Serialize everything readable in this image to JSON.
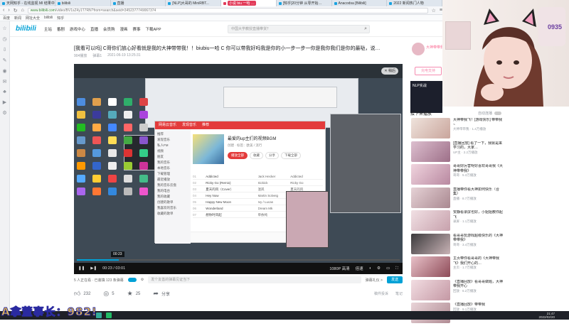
{
  "browser": {
    "tabs": [
      {
        "label": "天网知乎 - 在线监视 MI 结果中",
        "active": false
      },
      {
        "label": "bilibili",
        "active": false
      },
      {
        "label": "直播",
        "active": false
      },
      {
        "label": "[NLP]大哥的 MiniRBT...",
        "active": false
      },
      {
        "label": "小说 biu 一哈 …",
        "active": true
      },
      {
        "label": "[知乎]20分钟 从零开始…",
        "active": false
      },
      {
        "label": "Anacodsa [Bilibili]",
        "active": false
      },
      {
        "label": "2022 新闻热门人物",
        "active": false
      }
    ],
    "url_host": "www.bilibili.com",
    "url_path": "/video/BV1sZ4y1T7RN?from=search&seid=3452377749067374",
    "bookmarks": [
      "百度",
      "新闻",
      "网址大全",
      "bilibili",
      "知乎"
    ]
  },
  "bili": {
    "logo": "bilibili",
    "nav": [
      "主站",
      "番剧",
      "游戏中心",
      "直播",
      "会员购",
      "漫画",
      "赛事",
      "下载APP"
    ],
    "search_placeholder": "中国大学教授直播带货？"
  },
  "video": {
    "title": "[我看可以吗] C哥你们放心好看就是我的大神带带我！！biubiu一哈 C 你可以带我好吗我是你的小一步一步一你是我你我们是你的最哒，说…",
    "views": "904播放",
    "danmaku_count": "弹幕1",
    "date": "2021-06-19 13:25:31",
    "float_btn": "✕ 稍后",
    "time_tip": "00:23",
    "current_time": "00:23 / 03:01",
    "quality": "1080P 高清",
    "speed": "倍速",
    "progress": 0.13
  },
  "music_app": {
    "tabs": [
      "网易云音乐",
      "发现音乐",
      "推荐"
    ],
    "sidebar": [
      "推荐",
      "发现音乐",
      "私人FM",
      "视频",
      "朋友",
      "我的音乐",
      "本地音乐",
      "下载管理",
      "最近播放",
      "我的音乐云盘",
      "我的电台",
      "我的收藏",
      "创建的歌单",
      "我喜欢的音乐",
      "收藏的歌单"
    ],
    "playlist_title": "最爱的up主们的视频BGM",
    "playlist_sub": "创建 · 标签：欧美 / 流行",
    "buttons": [
      "播放全部",
      "收藏",
      "分享",
      "下载全部"
    ],
    "tracks": [
      {
        "n": "01",
        "t": "Addicted",
        "a": "Jack Hecker",
        "al": "Addicted"
      },
      {
        "n": "02",
        "t": "Ricky Go (Remix)",
        "a": "Sickick",
        "al": "Ricky Go"
      },
      {
        "n": "03",
        "t": "夏天的风（Cover）",
        "a": "温岚",
        "al": "夏天的风"
      },
      {
        "n": "04",
        "t": "Hey Now",
        "a": "Martin Solveig",
        "al": "Hey Now"
      },
      {
        "n": "05",
        "t": "Happy New Moon",
        "a": "Ivy / Lucas",
        "al": "Happy New"
      },
      {
        "n": "06",
        "t": "Wonderland",
        "a": "Dream Mk",
        "al": "Wonderland"
      },
      {
        "n": "07",
        "t": "想你时风起",
        "a": "单依纯",
        "al": "想你时风起"
      }
    ]
  },
  "danmaku": {
    "viewers": "5 人正在看 · 已装填 123 条弹幕",
    "input_placeholder": "发个友善的弹幕见证当下",
    "etiquette": "弹幕礼仪 >",
    "send": "发送"
  },
  "actions": {
    "like": "232",
    "coin": "5",
    "fav": "25",
    "share": "分享",
    "report": "稿件投诉",
    "notes": "笔记"
  },
  "up": {
    "name": "大神带带我",
    "charge": "充电支持"
  },
  "ad": {
    "text": "NLP实战"
  },
  "recommend": {
    "header": "接下来播放",
    "autoplay": "自动连播",
    "items": [
      {
        "title": "大神带我飞！[游戏快乐] 带带我~",
        "meta": "大神带带我 · 1.4万播放"
      },
      {
        "title": "[直播回放] 看了一下，我就是来学习的，大家…",
        "meta": "UP主 · 2.2万播放"
      },
      {
        "title": "哥哥好厉害呀好喜欢哥哥我《大神带带我》",
        "meta": "哥哥 · 5.3万播放"
      },
      {
        "title": "直播带你看大神如何快乐（合集）",
        "meta": "直播 · 8.7万播放"
      },
      {
        "title": "安静看录屏也好，小姐姐教你起飞",
        "meta": "录屏 · 1.1万播放"
      },
      {
        "title": "看哥哥玩游戏超级快乐的《大神带带我》",
        "meta": "哥哥 · 3.4万播放"
      },
      {
        "title": "主页带你看哥哥的《大神带我飞》我们开心的…",
        "meta": "主页 · 1.7万播放"
      },
      {
        "title": "《直播回放》看哥哥做题，大神带我开心",
        "meta": "回放 · 6.2万播放"
      },
      {
        "title": "《直播回放》带带我",
        "meta": "回放 · 9.1万播放"
      }
    ]
  },
  "stream_overlay": {
    "score_text": "A拿董事长：982!",
    "cam_sticker": "0935"
  },
  "tray": {
    "time": "21:47",
    "date": "2022/02/20"
  }
}
